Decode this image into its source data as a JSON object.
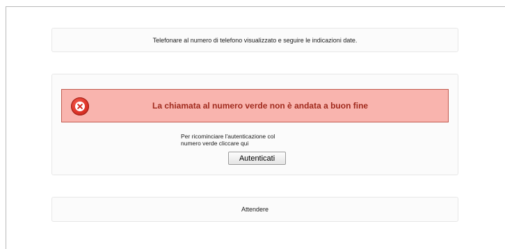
{
  "panel_instructions": {
    "text": "Telefonare al numero di telefono visualizzato e seguire le indicazioni date."
  },
  "error_panel": {
    "error_icon": "error-x-icon",
    "error_message": "La chiamata al numero verde non è andata a buon fine",
    "restart_line1": "Per ricominciare l'autenticazione col",
    "restart_line2": "numero verde cliccare qui",
    "button_label": "Autenticati"
  },
  "status_panel": {
    "text": "Attendere"
  },
  "colors": {
    "error_background": "#f9b4ae",
    "error_border": "#c15a4f",
    "error_text": "#a02a1d",
    "panel_background": "#fbfbfb"
  }
}
